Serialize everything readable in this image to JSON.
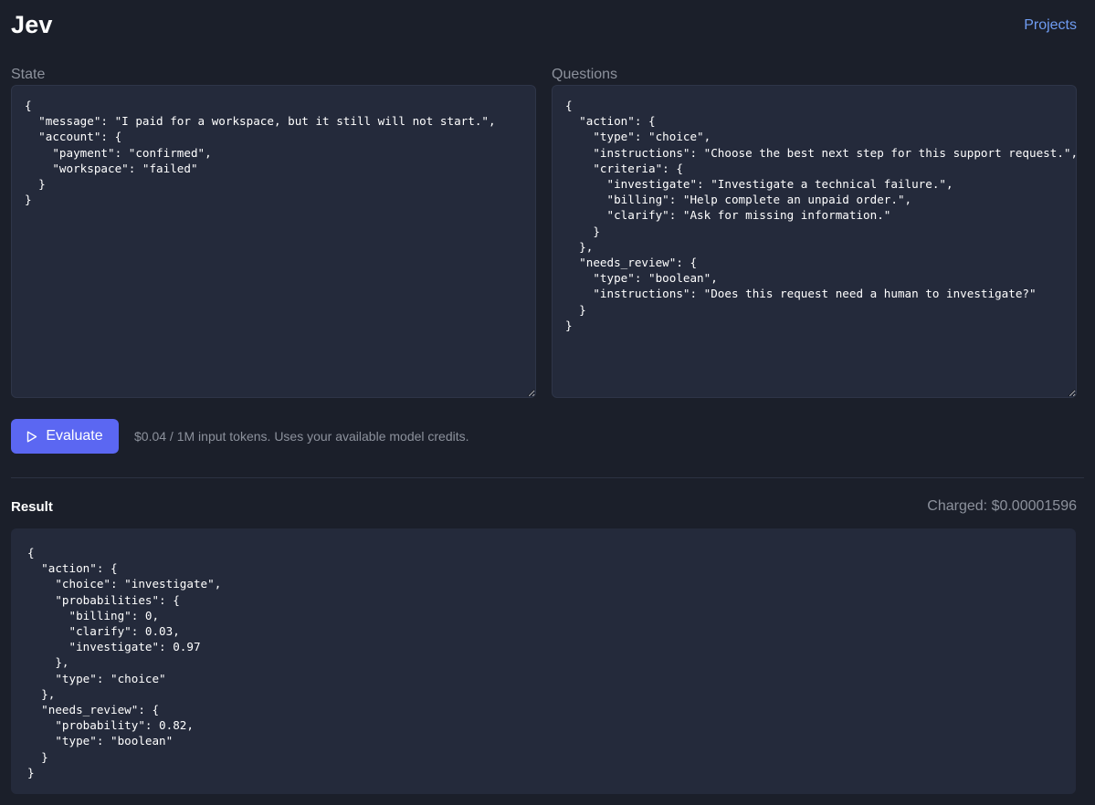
{
  "header": {
    "app_title": "Jev",
    "nav_link": "Projects"
  },
  "state": {
    "label": "State",
    "value": "{\n  \"message\": \"I paid for a workspace, but it still will not start.\",\n  \"account\": {\n    \"payment\": \"confirmed\",\n    \"workspace\": \"failed\"\n  }\n}"
  },
  "questions": {
    "label": "Questions",
    "value": "{\n  \"action\": {\n    \"type\": \"choice\",\n    \"instructions\": \"Choose the best next step for this support request.\",\n    \"criteria\": {\n      \"investigate\": \"Investigate a technical failure.\",\n      \"billing\": \"Help complete an unpaid order.\",\n      \"clarify\": \"Ask for missing information.\"\n    }\n  },\n  \"needs_review\": {\n    \"type\": \"boolean\",\n    \"instructions\": \"Does this request need a human to investigate?\"\n  }\n}"
  },
  "actions": {
    "evaluate_label": "Evaluate",
    "evaluate_icon": "play-icon",
    "pricing_note": "$0.04 / 1M input tokens. Uses your available model credits."
  },
  "result": {
    "heading": "Result",
    "charged": "Charged: $0.00001596",
    "output": "{\n  \"action\": {\n    \"choice\": \"investigate\",\n    \"probabilities\": {\n      \"billing\": 0,\n      \"clarify\": 0.03,\n      \"investigate\": 0.97\n    },\n    \"type\": \"choice\"\n  },\n  \"needs_review\": {\n    \"probability\": 0.82,\n    \"type\": \"boolean\"\n  }\n}"
  },
  "colors": {
    "background": "#1b1f2a",
    "panel": "#242a3b",
    "accent": "#5b67f2",
    "link": "#6f9cf2",
    "muted_text": "#8c919c"
  }
}
